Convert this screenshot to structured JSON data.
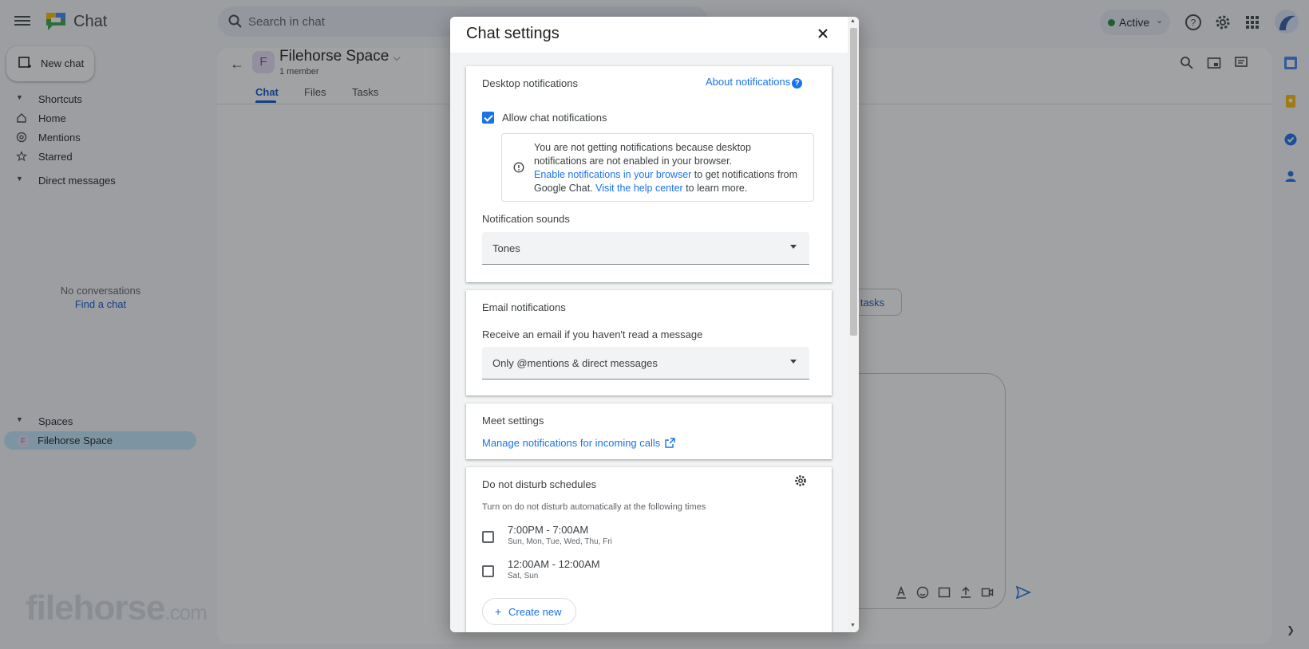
{
  "app": {
    "name": "Chat",
    "search_placeholder": "Search in chat",
    "status": "Active",
    "new_chat_label": "New chat"
  },
  "sidebar": {
    "shortcuts_label": "Shortcuts",
    "items": [
      {
        "label": "Home",
        "icon": "home-icon"
      },
      {
        "label": "Mentions",
        "icon": "at-icon"
      },
      {
        "label": "Starred",
        "icon": "star-icon"
      }
    ],
    "direct_messages_label": "Direct messages",
    "empty_text": "No conversations",
    "find_chat_link": "Find a chat",
    "spaces_label": "Spaces",
    "spaces": [
      {
        "initial": "F",
        "label": "Filehorse Space"
      }
    ]
  },
  "watermark": {
    "text": "filehorse",
    "suffix": ".com"
  },
  "space": {
    "initial": "F",
    "title": "Filehorse Space",
    "members": "1 member",
    "tabs": [
      "Chat",
      "Files",
      "Tasks"
    ],
    "active_tab": "Chat",
    "background_button_fragment": "n tasks"
  },
  "dialog": {
    "title": "Chat settings",
    "desktop": {
      "title": "Desktop notifications",
      "about_link": "About notifications",
      "allow_label": "Allow chat notifications",
      "allow_checked": true,
      "info_line1": "You are not getting notifications because desktop notifications are not enabled in your browser.",
      "info_link1": "Enable notifications in your browser",
      "info_mid": " to get notifications from Google Chat. ",
      "info_link2": "Visit the help center",
      "info_end": " to learn more.",
      "sounds_label": "Notification sounds",
      "sounds_value": "Tones"
    },
    "email": {
      "title": "Email notifications",
      "description": "Receive an email if you haven't read a message",
      "value": "Only @mentions & direct messages"
    },
    "meet": {
      "title": "Meet settings",
      "link": "Manage notifications for incoming calls"
    },
    "dnd": {
      "title": "Do not disturb schedules",
      "subtitle": "Turn on do not disturb automatically at the following times",
      "schedules": [
        {
          "time": "7:00PM - 7:00AM",
          "days": "Sun, Mon, Tue, Wed, Thu, Fri",
          "checked": false
        },
        {
          "time": "12:00AM - 12:00AM",
          "days": "Sat, Sun",
          "checked": false
        }
      ],
      "create_label": "Create new"
    }
  },
  "colors": {
    "accent": "#1a73e8",
    "active_status": "#1e8e3e",
    "scrim": "rgba(32,33,36,0.42)"
  }
}
